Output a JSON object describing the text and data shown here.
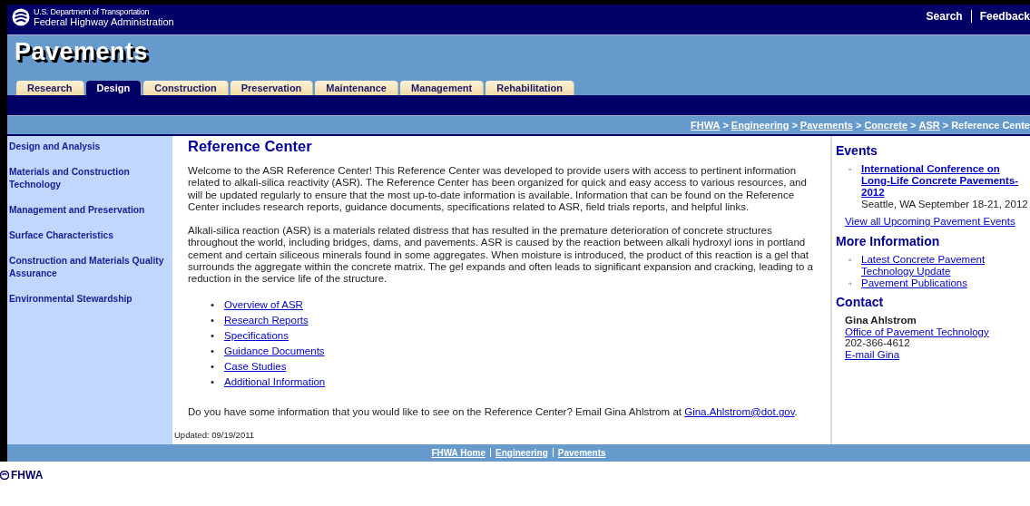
{
  "header": {
    "agency_line_1": "U.S. Department of Transportation",
    "agency_line_2": "Federal Highway Administration",
    "links": [
      "Search",
      "Feedback"
    ]
  },
  "site_title": "Pavements",
  "tabs": [
    {
      "label": "Research",
      "selected": false
    },
    {
      "label": "Design",
      "selected": true
    },
    {
      "label": "Construction",
      "selected": false
    },
    {
      "label": "Preservation",
      "selected": false
    },
    {
      "label": "Maintenance",
      "selected": false
    },
    {
      "label": "Management",
      "selected": false
    },
    {
      "label": "Rehabilitation",
      "selected": false
    }
  ],
  "breadcrumb": [
    {
      "label": "FHWA",
      "kind": "link"
    },
    {
      "separator": ">",
      "label": "Engineering",
      "kind": "link"
    },
    {
      "separator": ">",
      "label": "Pavements",
      "kind": "link"
    },
    {
      "separator": ">",
      "label": "Concrete",
      "kind": "link"
    },
    {
      "separator": ">",
      "label": "ASR",
      "kind": "link"
    },
    {
      "separator": ">",
      "label": "Reference Cente",
      "kind": "text"
    }
  ],
  "sidebar": {
    "items": [
      "Design and Analysis",
      "Materials and Construction Technology",
      "Management and Preservation",
      "Surface Characteristics",
      "Construction and Materials Quality Assurance",
      "Environmental Stewardship"
    ]
  },
  "main": {
    "heading": "Reference Center",
    "paragraphs": [
      "Welcome to the ASR Reference Center! This Reference Center was developed to provide users with access to pertinent information related to alkali-silica reactivity (ASR). The Reference Center has been organized for quick and easy access to various resources, and will be updated regularly to ensure that the most up-to-date information is available. Information that can be found on the Reference Center includes research reports, guidance documents, specifications related to ASR, field trials reports, and helpful links.",
      "Alkali-silica reaction (ASR) is a materials related distress that has resulted in the premature deterioration of concrete structures throughout the world, including bridges, dams, and pavements. ASR is caused by the reaction between alkali hydroxyl ions in portland cement and certain siliceous minerals found in some aggregates. When moisture is introduced, the product of this reaction is a gel that surrounds the aggregate within the concrete matrix. The gel expands and often leads to significant expansion and cracking, leading to a reduction in the service life of the structure."
    ],
    "links": [
      {
        "bullet": "•",
        "label": "Overview of ASR"
      },
      {
        "bullet": "•",
        "label": "Research Reports"
      },
      {
        "bullet": "•",
        "label": "Specifications"
      },
      {
        "bullet": "•",
        "label": "Guidance Documents"
      },
      {
        "bullet": "•",
        "label": "Case Studies"
      },
      {
        "bullet": "•",
        "label": "Additional Information"
      }
    ],
    "contact_prompt": {
      "text": "Do you have some information that you would like to see on the Reference Center? Email Gina Ahlstrom at",
      "email": "Gina.Ahlstrom@dot.gov",
      "end": "."
    },
    "updated": "Updated: 09/19/2011"
  },
  "right": {
    "events_heading": "Events",
    "events": [
      {
        "bullet": "◦",
        "title": "International Conference on Long-Life Concrete Pavements-2012",
        "details": "Seattle, WA September 18-21, 2012"
      }
    ],
    "view_all": "View all Upcoming Pavement Events",
    "more_heading": "More Information",
    "more_links": [
      {
        "bullet": "◦",
        "label": "Latest Concrete Pavement Technology Update"
      },
      {
        "bullet": "◦",
        "label": "Pavement Publications"
      }
    ],
    "contact_heading": "Contact",
    "contact": {
      "name": "Gina Ahlstrom",
      "office": "Office of Pavement Technology",
      "phone": "202-366-4612",
      "email": "E-mail Gina"
    }
  },
  "footer": {
    "links": [
      "FHWA Home",
      "Engineering",
      "Pavements"
    ],
    "logo": "FHWA"
  }
}
